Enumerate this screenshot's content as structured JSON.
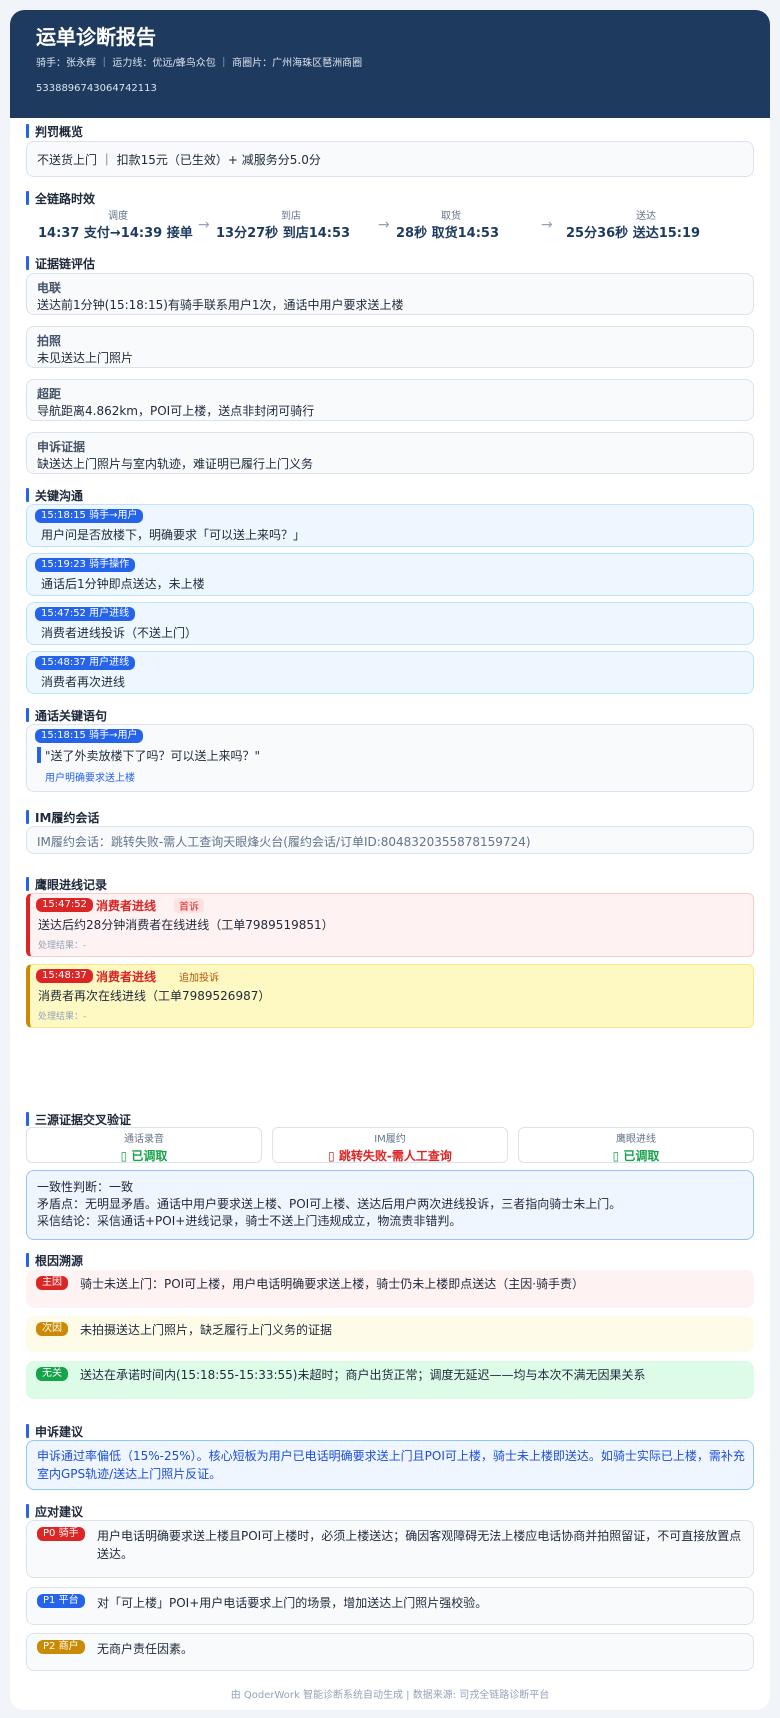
{
  "header": {
    "title": "运单诊断报告",
    "meta": "骑手：张永辉 ｜ 运力线：优远/蜂鸟众包 ｜ 商圈片：广州海珠区琶洲商圈",
    "order_id": "5338896743064742113"
  },
  "penalty": {
    "title": "判罚概览",
    "text": "不送货上门 ｜ 扣款15元（已生效）+ 减服务分5.0分"
  },
  "timeline": {
    "title": "全链路时效",
    "steps": [
      {
        "label": "调度",
        "value": "14:37 支付→14:39 接单"
      },
      {
        "label": "到店",
        "value": "13分27秒 到店14:53"
      },
      {
        "label": "取货",
        "value": "28秒 取货14:53"
      },
      {
        "label": "送达",
        "value": "25分36秒 送达15:19"
      }
    ],
    "arrow": "→"
  },
  "evidence": {
    "title": "证据链评估",
    "items": [
      {
        "label": "电联",
        "text": "送达前1分钟(15:18:15)有骑手联系用户1次，通话中用户要求送上楼"
      },
      {
        "label": "拍照",
        "text": "未见送达上门照片"
      },
      {
        "label": "超距",
        "text": "导航距离4.862km，POI可上楼，送点非封闭可骑行"
      },
      {
        "label": "申诉证据",
        "text": "缺送达上门照片与室内轨迹，难证明已履行上门义务"
      }
    ]
  },
  "comms": {
    "title": "关键沟通",
    "items": [
      {
        "tag": "15:18:15  骑手→用户",
        "text": "用户问是否放楼下，明确要求「可以送上来吗？」"
      },
      {
        "tag": "15:19:23  骑手操作",
        "text": "通话后1分钟即点送达，未上楼"
      },
      {
        "tag": "15:47:52  用户进线",
        "text": "消费者进线投诉（不送上门）"
      },
      {
        "tag": "15:48:37  用户进线",
        "text": "消费者再次进线"
      }
    ]
  },
  "call": {
    "title": "通话关键语句",
    "tag": "15:18:15  骑手→用户",
    "quote": "\"送了外卖放楼下了吗？可以送上来吗？\"",
    "note": "用户明确要求送上楼"
  },
  "im": {
    "title": "IM履约会话",
    "text": "IM履约会话：跳转失败-需人工查询天眼烽火台(履约会话/订单ID:8048320355878159724)"
  },
  "eagle": {
    "title": "鹰眼进线记录",
    "items": [
      {
        "time": "15:47:52",
        "kind": "消费者进线",
        "badge": "首诉",
        "text": "送达后约28分钟消费者在线进线（工单7989519851）",
        "result": "处理结果：-"
      },
      {
        "time": "15:48:37",
        "kind": "消费者进线",
        "badge": "追加投诉",
        "text": "消费者再次在线进线（工单7989526987）",
        "result": "处理结果：-"
      }
    ]
  },
  "cross": {
    "title": "三源证据交叉验证",
    "sources": [
      {
        "label": "通话录音",
        "value": "▯ 已调取",
        "color": "#16a34a"
      },
      {
        "label": "IM履约",
        "value": "▯ 跳转失败-需人工查询",
        "color": "#dc2626"
      },
      {
        "label": "鹰眼进线",
        "value": "▯ 已调取",
        "color": "#16a34a"
      }
    ],
    "conclusion": [
      "一致性判断：一致",
      "矛盾点：无明显矛盾。通话中用户要求送上楼、POI可上楼、送达后用户两次进线投诉，三者指向骑士未上门。",
      "采信结论：采信通话+POI+进线记录，骑士不送上门违规成立，物流责非错判。"
    ]
  },
  "root": {
    "title": "根因溯源",
    "items": [
      {
        "tag": "主因",
        "text": "骑士未送上门：POI可上楼，用户电话明确要求送上楼，骑士仍未上楼即点送达（主因·骑手责）",
        "bg": "#fef2f2",
        "tagbg": "#dc2626"
      },
      {
        "tag": "次因",
        "text": "未拍摄送达上门照片，缺乏履行上门义务的证据",
        "bg": "#fefce8",
        "tagbg": "#ca8a04"
      },
      {
        "tag": "无关",
        "text": "送达在承诺时间内(15:18:55-15:33:55)未超时；商户出货正常；调度无延迟——均与本次不满无因果关系",
        "bg": "#dcfce7",
        "tagbg": "#16a34a"
      }
    ]
  },
  "appeal": {
    "title": "申诉建议",
    "text": "申诉通过率偏低（15%-25%）。核心短板为用户已电话明确要求送上门且POI可上楼，骑士未上楼即送达。如骑士实际已上楼，需补充室内GPS轨迹/送达上门照片反证。"
  },
  "suggest": {
    "title": "应对建议",
    "items": [
      {
        "tag": "P0 骑手",
        "text": "用户电话明确要求送上楼且POI可上楼时，必须上楼送达；确因客观障碍无法上楼应电话协商并拍照留证，不可直接放置点送达。",
        "tagbg": "#dc2626"
      },
      {
        "tag": "P1 平台",
        "text": "对「可上楼」POI+用户电话要求上门的场景，增加送达上门照片强校验。",
        "tagbg": "#2563eb"
      },
      {
        "tag": "P2 商户",
        "text": "无商户责任因素。",
        "tagbg": "#ca8a04"
      }
    ]
  },
  "footer": "由 QoderWork 智能诊断系统自动生成 | 数据来源: 司戎全链路诊断平台"
}
